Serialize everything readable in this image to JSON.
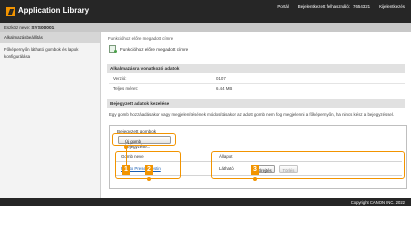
{
  "header": {
    "app_title": "Application Library",
    "portal": "Portál",
    "user_label": "Bejelentkezett felhasználó:",
    "user_id": "7654321",
    "logout": "Kijelentkezés"
  },
  "device": {
    "prefix": "Eszköz neve:",
    "name": "SYS00001"
  },
  "sidebar": {
    "header": "Alkalmazásbeállítás",
    "items": [
      {
        "label": "Főképernyőn látható gombok és lapok konfigurálása"
      }
    ]
  },
  "main": {
    "breadcrumb": "Funkcióhoz előre megadott címre",
    "app_name": "Funkcióhoz előre megadott címre",
    "info_section": {
      "title": "Alkalmazásra vonatkozó adatok",
      "version_label": "Verzió:",
      "version_value": "0107",
      "size_label": "Teljes méret:",
      "size_value": "6.44 MB"
    },
    "registered_section": {
      "title": "Bejegyzett adatok kezelése",
      "description": "Egy gomb hozzáadásakor vagy megjelenítésének módosításakor az adott gomb nem fog megjelenni a főképernyőn, ha nincs kész a bejegyzéssel.",
      "box_title": "Bejegyzett gombok",
      "add_button": "Új gomb bejegyzése...",
      "col_name": "Gomb neve",
      "col_status": "Állapot",
      "rows": [
        {
          "name": "Fax to Preset Destin",
          "status": "Látható",
          "edit": "Elrejtés",
          "delete": "Törlés"
        }
      ]
    }
  },
  "callouts": [
    "1",
    "2",
    "3"
  ],
  "footer": {
    "copyright": "Copyright CANON INC. 2022"
  },
  "colors": {
    "accent": "#f29400",
    "dark_bar": "#262626",
    "link": "#1a5fb4"
  }
}
